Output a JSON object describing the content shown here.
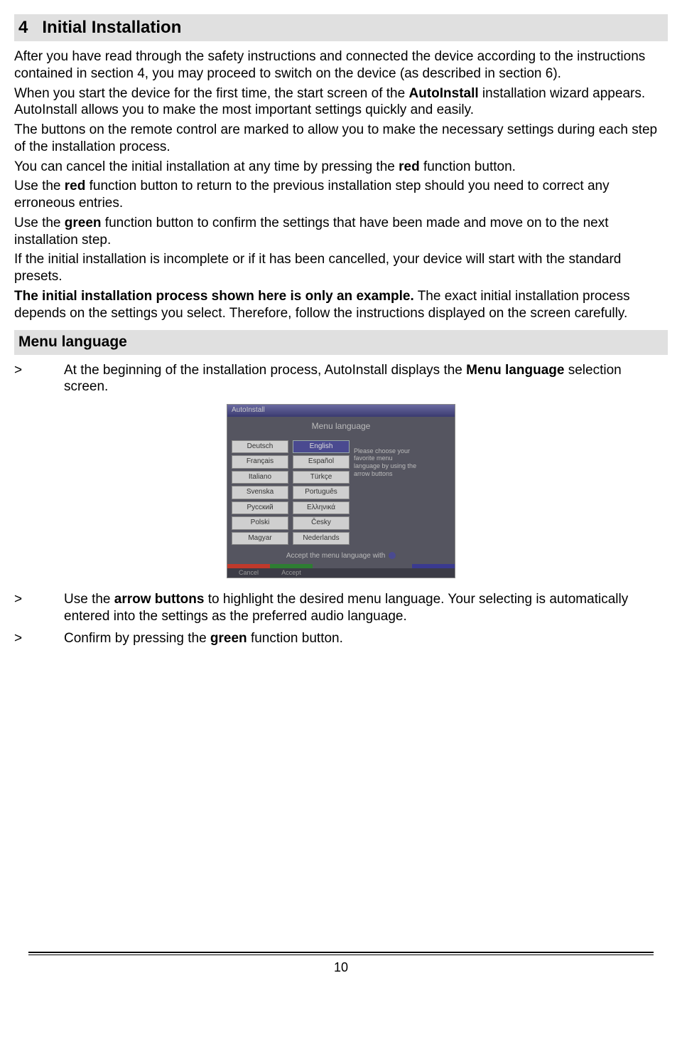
{
  "heading": {
    "number": "4",
    "title": "Initial Installation"
  },
  "paragraphs": {
    "p1a": "After you have read through the safety instructions and connected the device according to the instructions contained in section 4, you may proceed to switch on the device (as described in section 6).",
    "p1b_pre": "When you start the device for the first time, the start screen of the ",
    "p1b_bold": "AutoInstall",
    "p1b_post": " installation wizard appears. AutoInstall allows you to make the most important settings quickly and easily.",
    "p1c": "The buttons on the remote control are marked to allow you to make the necessary settings during each step of the installation process.",
    "p2_pre": "You can cancel the initial installation at any time by pressing the ",
    "p2_bold": "red",
    "p2_post": " function button.",
    "p3_pre": "Use the ",
    "p3_bold": "red",
    "p3_post": " function button to return to the previous installation step should you need to correct any erroneous entries.",
    "p4_pre": "Use the ",
    "p4_bold": "green",
    "p4_post": " function button to confirm the settings that have been made and move on to the next installation step.",
    "p5": "If the initial installation is incomplete or if it has been cancelled, your device will start with the standard presets.",
    "p6_bold": "The initial installation process shown here is only an example.",
    "p6_post": " The exact initial installation process depends on the settings you select. Therefore, follow the instructions displayed on the screen carefully."
  },
  "subheading": "Menu language",
  "steps": {
    "marker": ">",
    "s1_pre": "At the beginning of the installation process, AutoInstall displays the ",
    "s1_bold": "Menu language",
    "s1_post": " selection screen.",
    "s2_pre": "Use the ",
    "s2_bold": "arrow buttons",
    "s2_post": " to highlight the desired menu language. Your selecting is automatically entered into the settings as the preferred audio language.",
    "s3_pre": "Confirm by pressing the ",
    "s3_bold": "green",
    "s3_post": " function button."
  },
  "screenshot": {
    "titlebar": "AutoInstall",
    "header": "Menu language",
    "col1": [
      "Deutsch",
      "Français",
      "Italiano",
      "Svenska",
      "Русский",
      "Polski",
      "Magyar"
    ],
    "col2": [
      "English",
      "Español",
      "Türkçe",
      "Português",
      "Ελληνικά",
      "Česky",
      "Nederlands"
    ],
    "selected": "English",
    "hint": "Please choose your favorite menu language by using the arrow buttons",
    "footer": "Accept the menu language with",
    "cancel": "Cancel",
    "accept": "Accept"
  },
  "page_number": "10"
}
